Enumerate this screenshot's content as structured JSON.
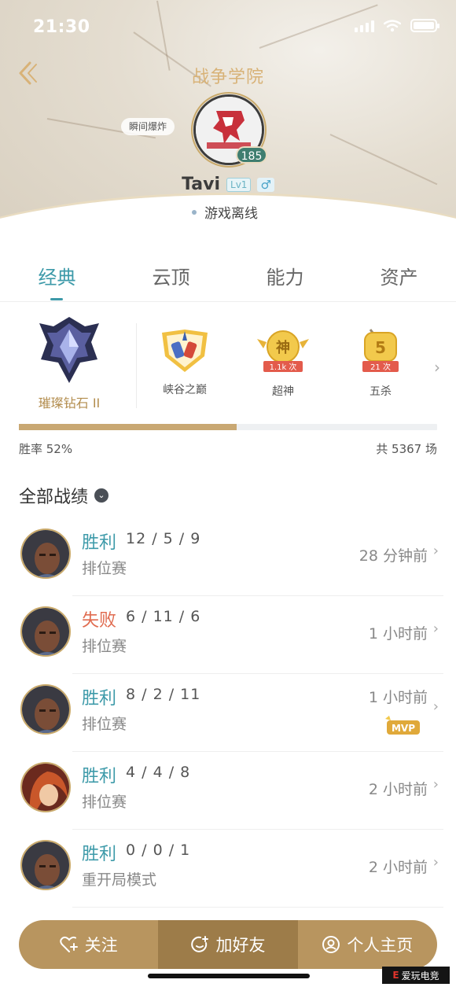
{
  "status_bar": {
    "time": "21:30"
  },
  "header": {
    "school": "战争学院",
    "status_tag": "瞬间爆炸",
    "avatar_level": "185",
    "name": "Tavi",
    "lv_badge": "Lv1",
    "gender_symbol": "♂",
    "presence": "游戏离线"
  },
  "tabs": [
    {
      "label": "经典",
      "active": true
    },
    {
      "label": "云顶",
      "active": false
    },
    {
      "label": "能力",
      "active": false
    },
    {
      "label": "资产",
      "active": false
    }
  ],
  "honors": {
    "rank": "璀璨钻石 II",
    "badges": [
      {
        "label": "峡谷之巅",
        "ribbon": ""
      },
      {
        "label": "超神",
        "emblem": "神",
        "ribbon": "1.1k 次"
      },
      {
        "label": "五杀",
        "emblem": "5",
        "ribbon": "21 次"
      }
    ]
  },
  "stats": {
    "win_rate_label": "胜率 52%",
    "win_rate": 0.52,
    "total_label": "共 5367 场"
  },
  "section_title": "全部战绩",
  "matches": [
    {
      "result": "胜利",
      "outcome": "win",
      "kda": "12 / 5 / 9",
      "mode": "排位赛",
      "time": "28 分钟前",
      "mvp": false,
      "champ": "dark"
    },
    {
      "result": "失败",
      "outcome": "lose",
      "kda": "6 / 11 / 6",
      "mode": "排位赛",
      "time": "1 小时前",
      "mvp": false,
      "champ": "dark"
    },
    {
      "result": "胜利",
      "outcome": "win",
      "kda": "8 / 2 / 11",
      "mode": "排位赛",
      "time": "1 小时前",
      "mvp": true,
      "mvp_label": "MVP",
      "champ": "dark"
    },
    {
      "result": "胜利",
      "outcome": "win",
      "kda": "4 / 4 / 8",
      "mode": "排位赛",
      "time": "2 小时前",
      "mvp": false,
      "champ": "red"
    },
    {
      "result": "胜利",
      "outcome": "win",
      "kda": "0 / 0 / 1",
      "mode": "重开局模式",
      "time": "2 小时前",
      "mvp": false,
      "champ": "dark"
    }
  ],
  "actions": {
    "follow": "关注",
    "add_friend": "加好友",
    "profile": "个人主页"
  },
  "watermark": {
    "brand": "爱玩电竞"
  },
  "colors": {
    "accent": "#3d9aa9",
    "lose": "#e06b4f",
    "gold": "#c9a873"
  }
}
